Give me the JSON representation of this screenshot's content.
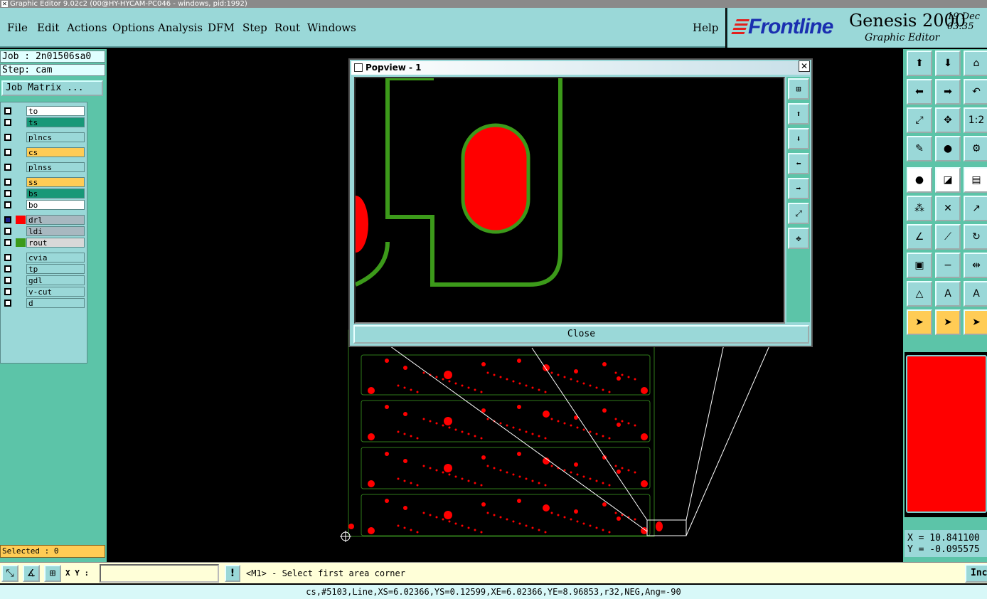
{
  "window": {
    "title": "Graphic Editor 9.02c2 (00@HY-HYCAM-PC046 - windows, pid:1992)"
  },
  "menu": {
    "items": [
      {
        "label": "File"
      },
      {
        "label": "Edit"
      },
      {
        "label": "Actions"
      },
      {
        "label": "Options"
      },
      {
        "label": "Analysis"
      },
      {
        "label": "DFM"
      },
      {
        "label": "Step"
      },
      {
        "label": "Rout"
      },
      {
        "label": "Windows"
      }
    ],
    "help": "Help"
  },
  "brand": {
    "logo": "Frontline",
    "product": "Genesis 2000",
    "subtitle": "Graphic Editor",
    "date": "19 Dec",
    "time": "03:35"
  },
  "left": {
    "job": "Job : 2n01506sa0",
    "step": "Step: cam",
    "job_matrix": "Job Matrix ...",
    "selected": "Selected : 0",
    "layers": [
      {
        "name": "to",
        "bg": "#ffffff"
      },
      {
        "name": "ts",
        "bg": "#189878"
      },
      {
        "name": "plncs",
        "bg": "#9ad8d8"
      },
      {
        "name": "cs",
        "bg": "#ffcc55"
      },
      {
        "name": "plnss",
        "bg": "#9ad8d8"
      },
      {
        "name": "ss",
        "bg": "#ffcc55"
      },
      {
        "name": "bs",
        "bg": "#189878"
      },
      {
        "name": "bo",
        "bg": "#ffffff"
      },
      {
        "name": "drl",
        "bg": "#a8b8c0",
        "swatch": "#ff0000"
      },
      {
        "name": "ldi",
        "bg": "#a8b8c0"
      },
      {
        "name": "rout",
        "bg": "#d8d8d8",
        "swatch": "#3c9a1a"
      },
      {
        "name": "cvia",
        "bg": "#9ad8d8"
      },
      {
        "name": "tp",
        "bg": "#9ad8d8"
      },
      {
        "name": "gdl",
        "bg": "#9ad8d8"
      },
      {
        "name": "v-cut",
        "bg": "#9ad8d8"
      },
      {
        "name": "d",
        "bg": "#9ad8d8"
      }
    ]
  },
  "popview": {
    "title": "Popview - 1",
    "close_label": "Close"
  },
  "right": {
    "x_coord": "X = 10.841100",
    "y_coord": "Y = -0.095575",
    "ratio_label": "1:2"
  },
  "bottom": {
    "xy_label": "X Y :",
    "xy_value": "",
    "exclaim": "!",
    "prompt": "<M1> - Select first area corner",
    "in_label": "Inc"
  },
  "status": "cs,#5103,Line,XS=6.02366,YS=0.12599,XE=6.02366,YE=8.96853,r32,NEG,Ang=-90",
  "colors": {
    "accent": "#9ad8d8",
    "panel": "#5cc4a8",
    "pad": "#ff0000",
    "rout": "#3c9a1a"
  }
}
